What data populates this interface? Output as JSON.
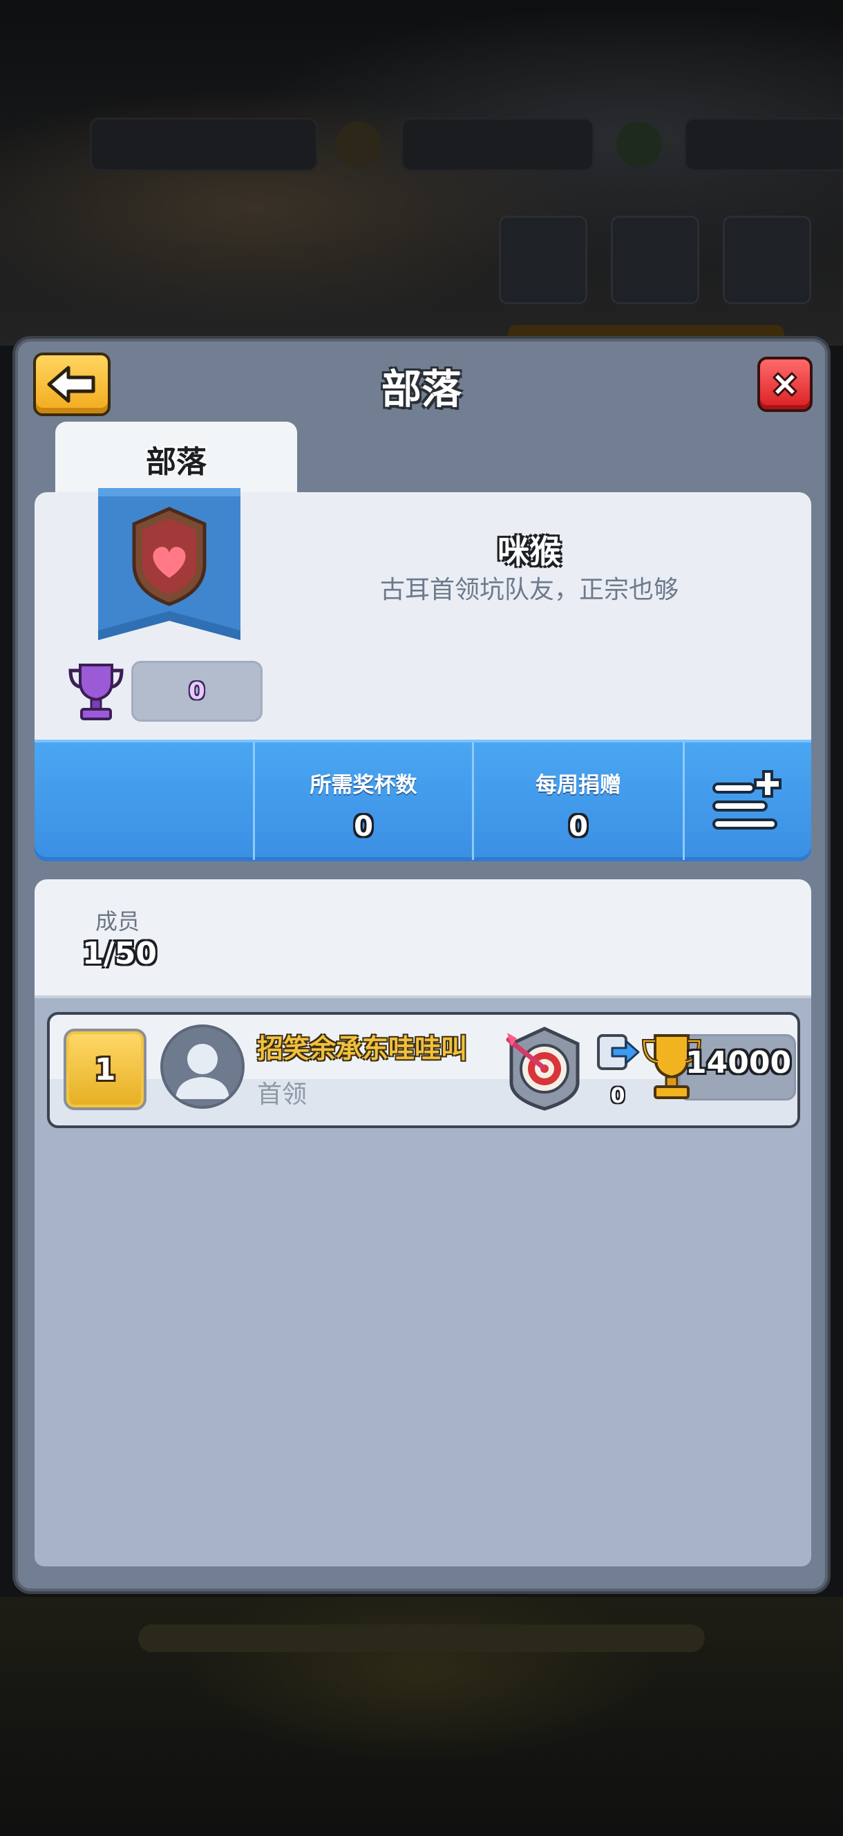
{
  "dialog": {
    "title": "部落"
  },
  "tabs": [
    {
      "label": "部落",
      "active": true
    }
  ],
  "clan": {
    "name": "咪猴",
    "description": "古耳首领坑队友，正宗也够",
    "trophies": "0",
    "badge_icon": "heart-shield-icon"
  },
  "stats": [
    {
      "label": "所需奖杯数",
      "value": "0"
    },
    {
      "label": "每周捐赠",
      "value": "0"
    }
  ],
  "members": {
    "label": "成员",
    "count": "1/50",
    "list": [
      {
        "rank": "1",
        "name": "招笑余承东哇哇叫",
        "role": "首领",
        "donations": "0",
        "trophies": "14000"
      }
    ]
  },
  "colors": {
    "dialog_bg": "#727f92",
    "stats_blue": "#3b8fe3",
    "gold": "#f2aa1c",
    "close_red": "#d91f23",
    "list_bg": "#a7b3c7"
  }
}
